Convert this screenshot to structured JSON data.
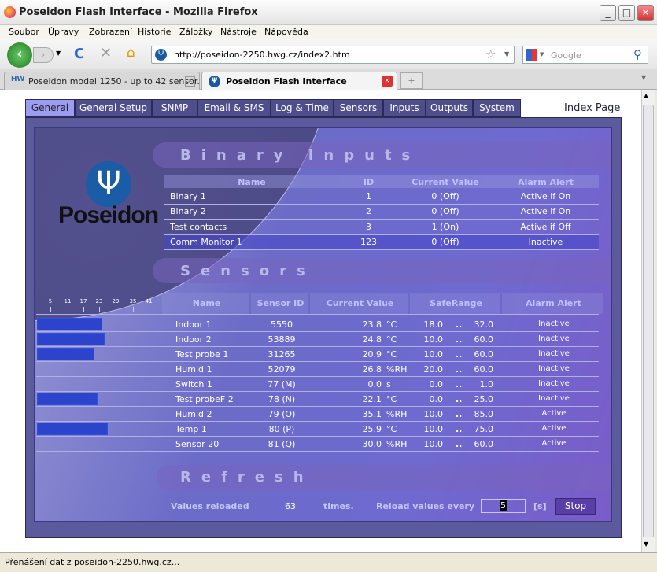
{
  "window": {
    "title": "Poseidon Flash Interface - Mozilla Firefox"
  },
  "menu": [
    "Soubor",
    "Úpravy",
    "Zobrazení",
    "Historie",
    "Záložky",
    "Nástroje",
    "Nápověda"
  ],
  "nav": {
    "url": "http://poseidon-2250.hwg.cz/index2.htm",
    "search_placeholder": "Google"
  },
  "browser_tabs": [
    {
      "label": "Poseidon model 1250 - up to 42 sensor..."
    },
    {
      "label": "Poseidon Flash Interface"
    }
  ],
  "status": "Přenášení dat z poseidon-2250.hwg.cz...",
  "app": {
    "tabs": [
      "General",
      "General Setup",
      "SNMP",
      "Email & SMS",
      "Log & Time",
      "Sensors",
      "Inputs",
      "Outputs",
      "System"
    ],
    "active_tab": "General",
    "index_link": "Index Page",
    "logo_text": "Poseidon",
    "binary": {
      "title": "Binary Inputs",
      "headers": [
        "Name",
        "ID",
        "Current Value",
        "Alarm Alert"
      ],
      "rows": [
        [
          "Binary 1",
          "1",
          "0 (Off)",
          "Active if On"
        ],
        [
          "Binary 2",
          "2",
          "0 (Off)",
          "Active if On"
        ],
        [
          "Test contacts",
          "3",
          "1 (On)",
          "Active if Off"
        ],
        [
          "Comm Monitor 1",
          "123",
          "0 (Off)",
          "Inactive"
        ]
      ]
    },
    "sensors": {
      "title": "Sensors",
      "headers": [
        "Name",
        "Sensor ID",
        "Current Value",
        "SafeRange",
        "Alarm Alert"
      ],
      "scale_ticks": [
        "5",
        "11",
        "17",
        "23",
        "29",
        "35",
        "41"
      ],
      "rows": [
        {
          "name": "Indoor 1",
          "id": "5550",
          "value": "23.8",
          "unit": "°C",
          "low": "18.0",
          "high": "32.0",
          "alarm": "Inactive",
          "bar": 23.8
        },
        {
          "name": "Indoor 2",
          "id": "53889",
          "value": "24.8",
          "unit": "°C",
          "low": "10.0",
          "high": "60.0",
          "alarm": "Inactive",
          "bar": 24.8
        },
        {
          "name": "Test probe 1",
          "id": "31265",
          "value": "20.9",
          "unit": "°C",
          "low": "10.0",
          "high": "60.0",
          "alarm": "Inactive",
          "bar": 20.9
        },
        {
          "name": "Humid 1",
          "id": "52079",
          "value": "26.8",
          "unit": "%RH",
          "low": "20.0",
          "high": "60.0",
          "alarm": "Inactive",
          "bar": 0
        },
        {
          "name": "Switch 1",
          "id": "77 (M)",
          "value": "0.0",
          "unit": "s",
          "low": "0.0",
          "high": "1.0",
          "alarm": "Inactive",
          "bar": 0
        },
        {
          "name": "Test probeF 2",
          "id": "78 (N)",
          "value": "22.1",
          "unit": "°C",
          "low": "0.0",
          "high": "25.0",
          "alarm": "Inactive",
          "bar": 22.1
        },
        {
          "name": "Humid 2",
          "id": "79 (O)",
          "value": "35.1",
          "unit": "%RH",
          "low": "10.0",
          "high": "85.0",
          "alarm": "Active",
          "bar": 0
        },
        {
          "name": "Temp 1",
          "id": "80 (P)",
          "value": "25.9",
          "unit": "°C",
          "low": "10.0",
          "high": "75.0",
          "alarm": "Active",
          "bar": 25.9
        },
        {
          "name": "Sensor 20",
          "id": "81 (Q)",
          "value": "30.0",
          "unit": "%RH",
          "low": "10.0",
          "high": "60.0",
          "alarm": "Active",
          "bar": 0
        }
      ],
      "range_sep": ".."
    },
    "refresh": {
      "title": "Refresh",
      "reloaded_label": "Values reloaded",
      "count": "63",
      "times_label": "times.",
      "every_label": "Reload values every",
      "interval": "5",
      "unit": "[s]",
      "stop_label": "Stop"
    }
  }
}
